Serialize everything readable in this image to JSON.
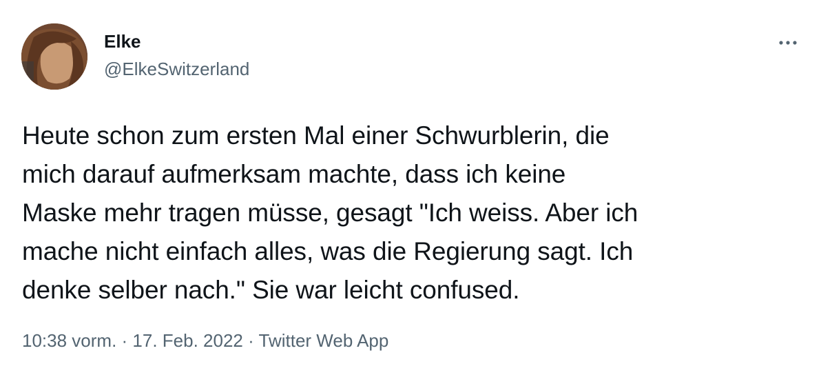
{
  "author": {
    "name": "Elke",
    "handle": "@ElkeSwitzerland",
    "avatar_icon": "avatar-photo"
  },
  "more_icon": "more-horizontal-icon",
  "tweet": {
    "text": "Heute schon zum ersten Mal einer Schwurblerin, die\nmich darauf aufmerksam machte, dass ich keine\nMaske mehr tragen müsse, gesagt \"Ich weiss. Aber ich\nmache nicht einfach alles, was die Regierung sagt. Ich\ndenke selber nach.\" Sie war leicht confused."
  },
  "meta": {
    "time": "10:38 vorm.",
    "separator": " · ",
    "date": "17. Feb. 2022",
    "source": "Twitter Web App"
  },
  "colors": {
    "text": "#0f1419",
    "secondary": "#536471",
    "background": "#ffffff"
  }
}
